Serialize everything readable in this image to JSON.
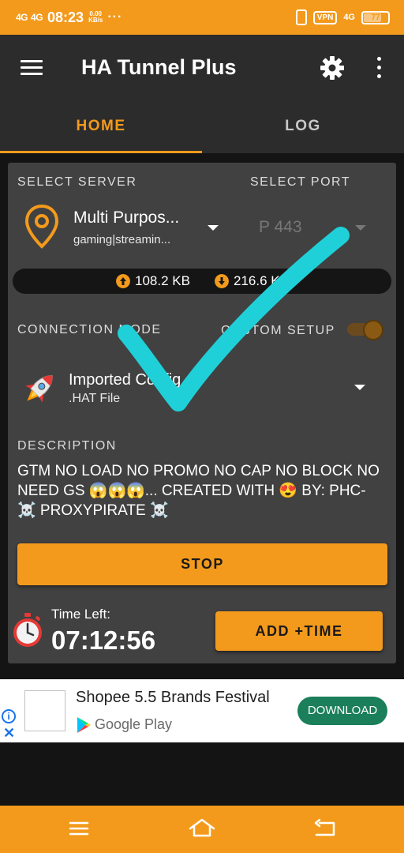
{
  "status_bar": {
    "signal_1": "4G",
    "signal_2": "4G",
    "time": "08:23",
    "speed_value": "0.00",
    "speed_unit": "KB/s",
    "dots": "···",
    "vpn_label": "VPN",
    "network": "4G",
    "battery": "77"
  },
  "app_bar": {
    "title": "HA Tunnel Plus"
  },
  "tabs": [
    {
      "label": "HOME",
      "selected": true
    },
    {
      "label": "LOG",
      "selected": false
    }
  ],
  "server": {
    "section_label": "SELECT SERVER",
    "name": "Multi Purpos...",
    "subtitle": "gaming|streamin..."
  },
  "port": {
    "section_label": "SELECT PORT",
    "value": "P 443"
  },
  "transfer": {
    "upload": "108.2 KB",
    "download": "216.6 KB"
  },
  "connection": {
    "section_label": "CONNECTION MODE",
    "custom_setup_label": "CUSTOM SETUP",
    "custom_setup_on": true,
    "mode_name": "Imported Config",
    "mode_sub": ".HAT File"
  },
  "description": {
    "section_label": "DESCRIPTION",
    "text": "GTM NO LOAD NO PROMO NO CAP NO BLOCK NO NEED GS 😱😱😱... CREATED WITH 😍 BY: PHC- ☠️ PROXYPIRATE ☠️"
  },
  "stop_button": "STOP",
  "timer": {
    "label": "Time Left:",
    "value": "07:12:56",
    "add_button": "ADD +TIME"
  },
  "ad": {
    "title": "Shopee 5.5 Brands Festival",
    "store": "Google Play",
    "cta": "DOWNLOAD",
    "info_icon": "i",
    "close_icon": "✕"
  },
  "colors": {
    "accent": "#f39a1c",
    "app_bar": "#2c2c2c",
    "card": "#414141",
    "checkmark": "#1fd0d8",
    "download_button": "#1a7f5a"
  }
}
